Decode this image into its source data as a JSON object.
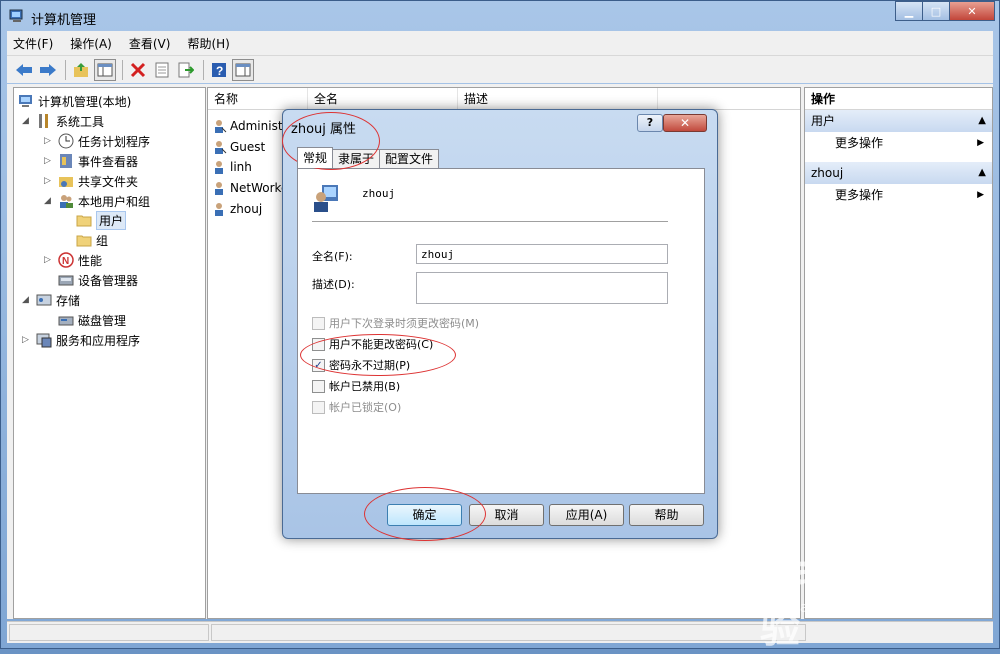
{
  "window": {
    "title": "计算机管理",
    "minimize": "▁",
    "maximize": "□",
    "close": "✕"
  },
  "menu": [
    "文件(F)",
    "操作(A)",
    "查看(V)",
    "帮助(H)"
  ],
  "tree": {
    "root": "计算机管理(本地)",
    "items": [
      {
        "label": "系统工具"
      },
      {
        "label": "任务计划程序"
      },
      {
        "label": "事件查看器"
      },
      {
        "label": "共享文件夹"
      },
      {
        "label": "本地用户和组"
      },
      {
        "label": "用户"
      },
      {
        "label": "组"
      },
      {
        "label": "性能"
      },
      {
        "label": "设备管理器"
      },
      {
        "label": "存储"
      },
      {
        "label": "磁盘管理"
      },
      {
        "label": "服务和应用程序"
      }
    ]
  },
  "list": {
    "columns": [
      "名称",
      "全名",
      "描述"
    ],
    "rows": [
      "Administr",
      "Guest",
      "linh",
      "NetWorke",
      "zhouj"
    ]
  },
  "actions": {
    "header": "操作",
    "sections": [
      {
        "title": "用户",
        "item": "更多操作"
      },
      {
        "title": "zhouj",
        "item": "更多操作"
      }
    ]
  },
  "dialog": {
    "title": "zhouj 属性",
    "help": "?",
    "close": "✕",
    "tabs": [
      "常规",
      "隶属于",
      "配置文件"
    ],
    "username": "zhouj",
    "fullname_label": "全名(F):",
    "fullname_value": "zhouj",
    "desc_label": "描述(D):",
    "desc_value": "",
    "checkboxes": [
      {
        "label": "用户下次登录时须更改密码(M)",
        "checked": false,
        "enabled": false
      },
      {
        "label": "用户不能更改密码(C)",
        "checked": false,
        "enabled": true
      },
      {
        "label": "密码永不过期(P)",
        "checked": true,
        "enabled": true
      },
      {
        "label": "帐户已禁用(B)",
        "checked": false,
        "enabled": true
      },
      {
        "label": "帐户已锁定(O)",
        "checked": false,
        "enabled": false
      }
    ],
    "buttons": [
      "确定",
      "取消",
      "应用(A)",
      "帮助"
    ]
  },
  "watermark": {
    "logo": "Bai du 经验",
    "url": "jingyan.baidu.com"
  },
  "colors": {
    "accent": "#3c7fb1",
    "annotation": "#dd3333"
  }
}
